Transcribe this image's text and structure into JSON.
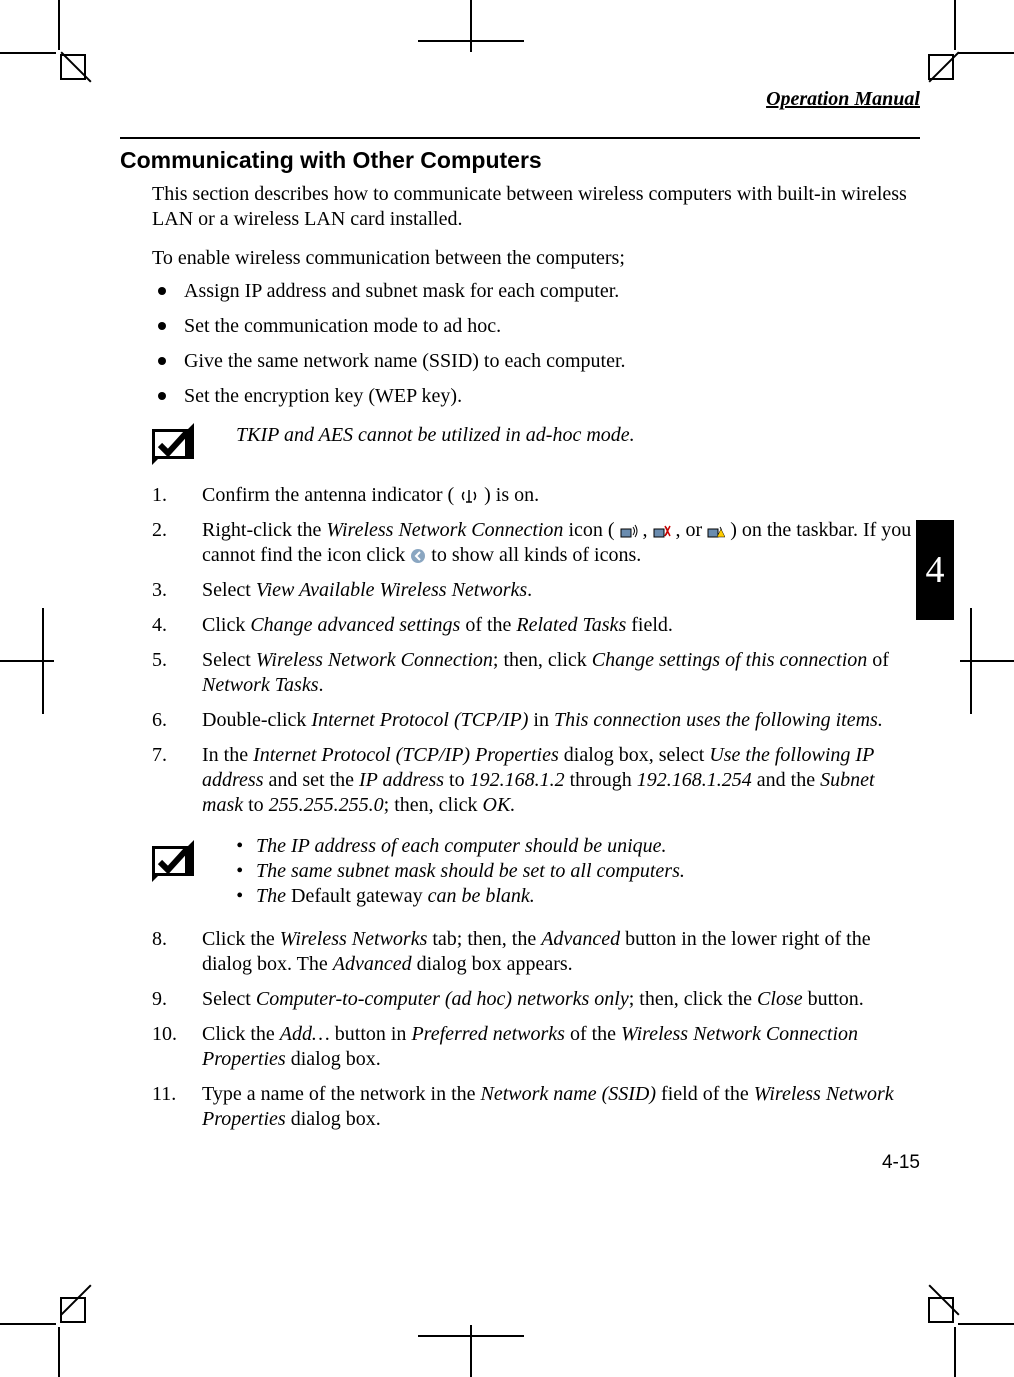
{
  "header": {
    "title": "Operation Manual"
  },
  "section": {
    "title": "Communicating with Other Computers"
  },
  "intro": "This section describes how to communicate between wireless computers with built-in wireless LAN or a wireless LAN card installed.",
  "enable_intro": "To enable wireless communication between the computers;",
  "bullets": [
    "Assign IP address and subnet mask for each computer.",
    "Set the communication mode to ad hoc.",
    "Give the same network name (SSID) to each computer.",
    "Set the encryption key (WEP key)."
  ],
  "note1": "TKIP and AES cannot be utilized in ad-hoc mode.",
  "steps": {
    "s1_a": "Confirm the antenna indicator (",
    "s1_b": ") is on.",
    "s2_a": "Right-click the ",
    "s2_wnc": "Wireless Network Connection",
    "s2_b": " icon (",
    "s2_c": ", ",
    "s2_d": ", or ",
    "s2_e": ") on the taskbar. If you cannot find the icon click ",
    "s2_f": " to show all kinds of icons.",
    "s3_a": "Select ",
    "s3_i": "View Available Wireless Networks",
    "s3_b": ".",
    "s4_a": "Click ",
    "s4_i1": "Change advanced settings",
    "s4_b": " of the ",
    "s4_i2": "Related Tasks",
    "s4_c": " field.",
    "s5_a": "Select ",
    "s5_i1": "Wireless Network Connection",
    "s5_b": "; then, click ",
    "s5_i2": "Change settings of this connection",
    "s5_c": " of ",
    "s5_i3": "Network Tasks",
    "s5_d": ".",
    "s6_a": "Double-click ",
    "s6_i1": "Internet Protocol (TCP/IP)",
    "s6_b": " in ",
    "s6_i2": "This connection uses the following items.",
    "s7_a": "In the ",
    "s7_i1": "Internet Protocol (TCP/IP) Properties",
    "s7_b": " dialog box, select ",
    "s7_i2": "Use the following IP address",
    "s7_c": " and set the ",
    "s7_i3": "IP address",
    "s7_d": " to ",
    "s7_i4": "192.168.1.2",
    "s7_e": " through ",
    "s7_i5": "192.168.1.254",
    "s7_f": " and the ",
    "s7_i6": "Subnet mask",
    "s7_g": " to ",
    "s7_i7": "255.255.255.0",
    "s7_h": "; then, click ",
    "s7_i8": "OK.",
    "s8_a": "Click the ",
    "s8_i1": "Wireless Networks",
    "s8_b": " tab; then, the ",
    "s8_i2": "Advanced",
    "s8_c": " button in the lower right of the dialog box. The ",
    "s8_i3": "Advanced",
    "s8_d": " dialog box appears.",
    "s9_a": "Select ",
    "s9_i1": "Computer-to-computer (ad hoc) networks only",
    "s9_b": "; then, click the ",
    "s9_i2": "Close",
    "s9_c": " button.",
    "s10_a": "Click the ",
    "s10_i1": "Add…",
    "s10_b": " button in ",
    "s10_i2": "Preferred networks",
    "s10_c": " of the ",
    "s10_i3": "Wireless Network Connection Properties",
    "s10_d": " dialog box.",
    "s11_a": "Type a name of the network in the ",
    "s11_i1": "Network name (SSID)",
    "s11_b": " field of the ",
    "s11_i2": "Wireless Network Properties",
    "s11_c": " dialog box."
  },
  "note2": {
    "b1": "The IP address of each computer should be unique.",
    "b2": "The same subnet mask should be set to all computers.",
    "b3_a": "The ",
    "b3_r": "Default gateway",
    "b3_b": " can be blank."
  },
  "chapter": "4",
  "page_number": "4-15"
}
